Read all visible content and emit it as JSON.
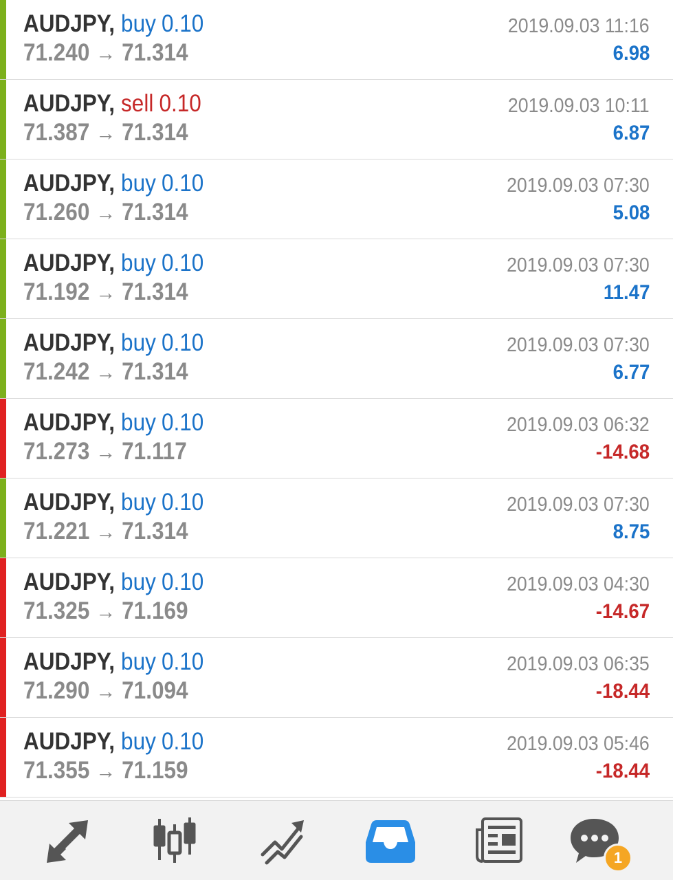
{
  "trades": [
    {
      "symbol": "AUDJPY",
      "direction": "buy",
      "volume": "0.10",
      "open_price": "71.240",
      "close_price": "71.314",
      "time": "2019.09.03 11:16",
      "profit": "6.98",
      "status": "profit"
    },
    {
      "symbol": "AUDJPY",
      "direction": "sell",
      "volume": "0.10",
      "open_price": "71.387",
      "close_price": "71.314",
      "time": "2019.09.03 10:11",
      "profit": "6.87",
      "status": "profit"
    },
    {
      "symbol": "AUDJPY",
      "direction": "buy",
      "volume": "0.10",
      "open_price": "71.260",
      "close_price": "71.314",
      "time": "2019.09.03 07:30",
      "profit": "5.08",
      "status": "profit"
    },
    {
      "symbol": "AUDJPY",
      "direction": "buy",
      "volume": "0.10",
      "open_price": "71.192",
      "close_price": "71.314",
      "time": "2019.09.03 07:30",
      "profit": "11.47",
      "status": "profit"
    },
    {
      "symbol": "AUDJPY",
      "direction": "buy",
      "volume": "0.10",
      "open_price": "71.242",
      "close_price": "71.314",
      "time": "2019.09.03 07:30",
      "profit": "6.77",
      "status": "profit"
    },
    {
      "symbol": "AUDJPY",
      "direction": "buy",
      "volume": "0.10",
      "open_price": "71.273",
      "close_price": "71.117",
      "time": "2019.09.03 06:32",
      "profit": "-14.68",
      "status": "loss"
    },
    {
      "symbol": "AUDJPY",
      "direction": "buy",
      "volume": "0.10",
      "open_price": "71.221",
      "close_price": "71.314",
      "time": "2019.09.03 07:30",
      "profit": "8.75",
      "status": "profit"
    },
    {
      "symbol": "AUDJPY",
      "direction": "buy",
      "volume": "0.10",
      "open_price": "71.325",
      "close_price": "71.169",
      "time": "2019.09.03 04:30",
      "profit": "-14.67",
      "status": "loss"
    },
    {
      "symbol": "AUDJPY",
      "direction": "buy",
      "volume": "0.10",
      "open_price": "71.290",
      "close_price": "71.094",
      "time": "2019.09.03 06:35",
      "profit": "-18.44",
      "status": "loss"
    },
    {
      "symbol": "AUDJPY",
      "direction": "buy",
      "volume": "0.10",
      "open_price": "71.355",
      "close_price": "71.159",
      "time": "2019.09.03 05:46",
      "profit": "-18.44",
      "status": "loss"
    }
  ],
  "arrow_glyph": "→",
  "bottom_nav": {
    "items": [
      {
        "name": "quotes-icon",
        "active": false
      },
      {
        "name": "chart-icon",
        "active": false
      },
      {
        "name": "trade-icon",
        "active": false
      },
      {
        "name": "history-icon",
        "active": true
      },
      {
        "name": "news-icon",
        "active": false
      },
      {
        "name": "messages-icon",
        "active": false
      }
    ],
    "messages_badge": "1"
  },
  "colors": {
    "profit_bar": "#7cb01c",
    "loss_bar": "#e02121",
    "buy": "#1b73c9",
    "sell": "#c62828",
    "nav_icon": "#555555",
    "nav_active": "#2a8ee6",
    "badge": "#f5a623"
  }
}
